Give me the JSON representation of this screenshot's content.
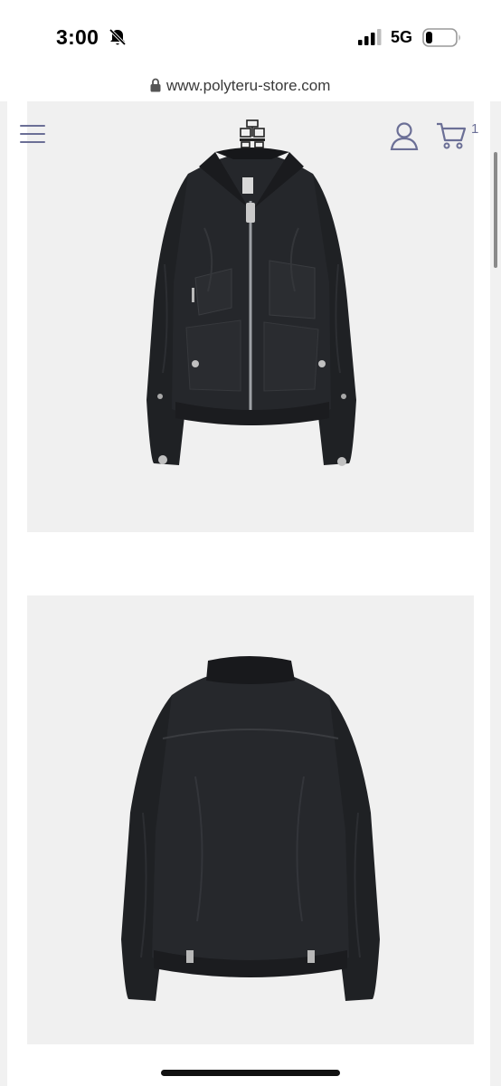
{
  "status_bar": {
    "time": "3:00",
    "network": "5G",
    "icons": [
      "bell-muted-icon",
      "signal-icon",
      "battery-icon"
    ]
  },
  "browser": {
    "url": "www.polyteru-store.com",
    "icons": [
      "lock-icon"
    ]
  },
  "header": {
    "icons": [
      "menu-icon",
      "logo-icon",
      "account-icon",
      "cart-icon"
    ],
    "cart_count": "1"
  },
  "product": {
    "images": [
      {
        "view": "front",
        "alt": "jacket-front"
      },
      {
        "view": "back",
        "alt": "jacket-back"
      }
    ]
  },
  "colors": {
    "icon_accent": "#6b6f96",
    "panel_bg": "#f0f0f0",
    "jacket": "#232528"
  }
}
